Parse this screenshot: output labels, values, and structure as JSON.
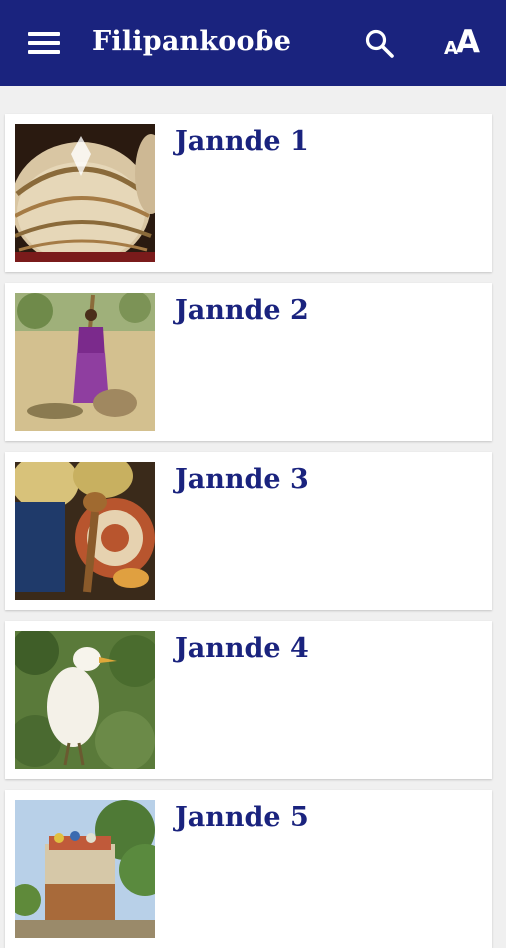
{
  "appbar": {
    "title": "Filipankooɓe",
    "menu_icon": "menu-icon",
    "search_icon": "search-icon",
    "font_size_icon": "font-size-icon",
    "font_size_glyph_small": "A",
    "font_size_glyph_large": "A",
    "color": "#1a237e"
  },
  "chapters": [
    {
      "label": "Jannde 1",
      "image": "woven-basket-lids-image"
    },
    {
      "label": "Jannde 2",
      "image": "woman-pounding-grain-image"
    },
    {
      "label": "Jannde 3",
      "image": "calabashes-and-baskets-image"
    },
    {
      "label": "Jannde 4",
      "image": "white-egret-bird-image"
    },
    {
      "label": "Jannde 5",
      "image": "loaded-truck-image"
    }
  ]
}
